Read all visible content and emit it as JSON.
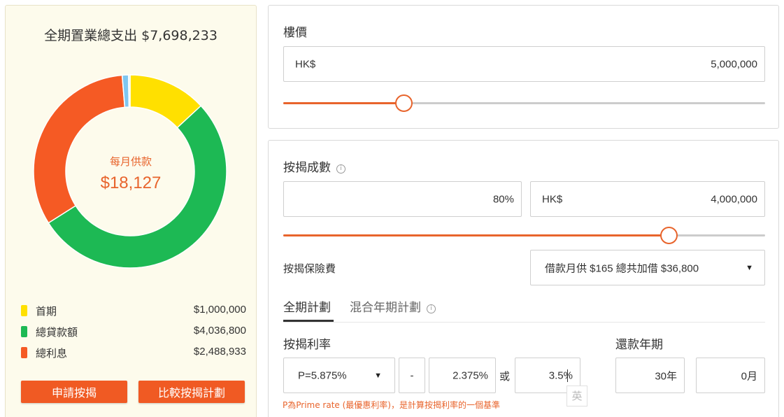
{
  "summary": {
    "total_title": "全期置業總支出 $7,698,233",
    "monthly_label": "每月供款",
    "monthly_value": "$18,127"
  },
  "breakdown": {
    "slices": [
      {
        "name": "首期",
        "value": 1000000,
        "display": "$1,000,000",
        "color": "#ffe000"
      },
      {
        "name": "總貸款額",
        "value": 4036800,
        "display": "$4,036,800",
        "color": "#1db954"
      },
      {
        "name": "總利息",
        "value": 2488933,
        "display": "$2,488,933",
        "color": "#f55a24"
      },
      {
        "name": "",
        "value": 80000,
        "display": "",
        "color": "#7fc6f0"
      },
      {
        "name": "",
        "value": 20000,
        "display": "",
        "color": "#cfe9f7"
      }
    ]
  },
  "actions": {
    "apply_label": "申請按揭",
    "compare_label": "比較按揭計劃"
  },
  "property": {
    "label": "樓價",
    "currency": "HK$",
    "value": "5,000,000",
    "slider_fraction": 0.25
  },
  "mortgage": {
    "label": "按揭成數",
    "info_icon": "info-icon",
    "percent": "80%",
    "currency": "HK$",
    "amount": "4,000,000",
    "slider_fraction": 0.8
  },
  "insurance": {
    "label": "按揭保險費",
    "selected": "借款月供 $165 總共加借 $36,800"
  },
  "plans": {
    "tabs": [
      {
        "label": "全期計劃",
        "active": true
      },
      {
        "label": "混合年期計劃",
        "active": false
      }
    ]
  },
  "rate": {
    "label": "按揭利率",
    "prime_selected": "P=5.875%",
    "dash": "-",
    "spread": "2.375%",
    "or": "或",
    "rate_value": "3.5%",
    "note": "P為Prime rate (最優惠利率)，是計算按揭利率的一個基準"
  },
  "term": {
    "label": "還款年期",
    "years": "30年",
    "months": "0月"
  },
  "ime": {
    "label": "英"
  }
}
